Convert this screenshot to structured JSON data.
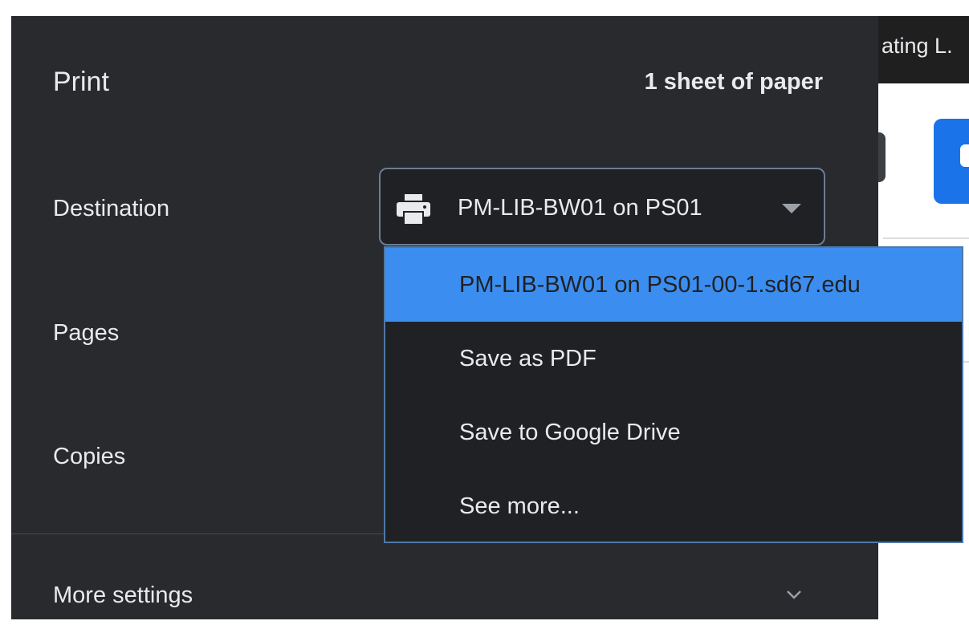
{
  "background_page": {
    "tab_title_fragment": "ating L."
  },
  "print_panel": {
    "title": "Print",
    "sheet_count": "1 sheet of paper",
    "labels": {
      "destination": "Destination",
      "pages": "Pages",
      "copies": "Copies",
      "more_settings": "More settings"
    },
    "destination": {
      "selected_value": "PM-LIB-BW01 on PS01",
      "icon": "printer-icon",
      "options": [
        {
          "label": "PM-LIB-BW01 on PS01-00-1.sd67.edu",
          "highlighted": true
        },
        {
          "label": "Save as PDF",
          "highlighted": false
        },
        {
          "label": "Save to Google Drive",
          "highlighted": false
        },
        {
          "label": "See more...",
          "highlighted": false
        }
      ]
    }
  },
  "colors": {
    "panel_background": "#292a2d",
    "select_background": "#202124",
    "highlight": "#3b8ef0",
    "text": "#e8eaed",
    "accent_button": "#1a73e8"
  }
}
